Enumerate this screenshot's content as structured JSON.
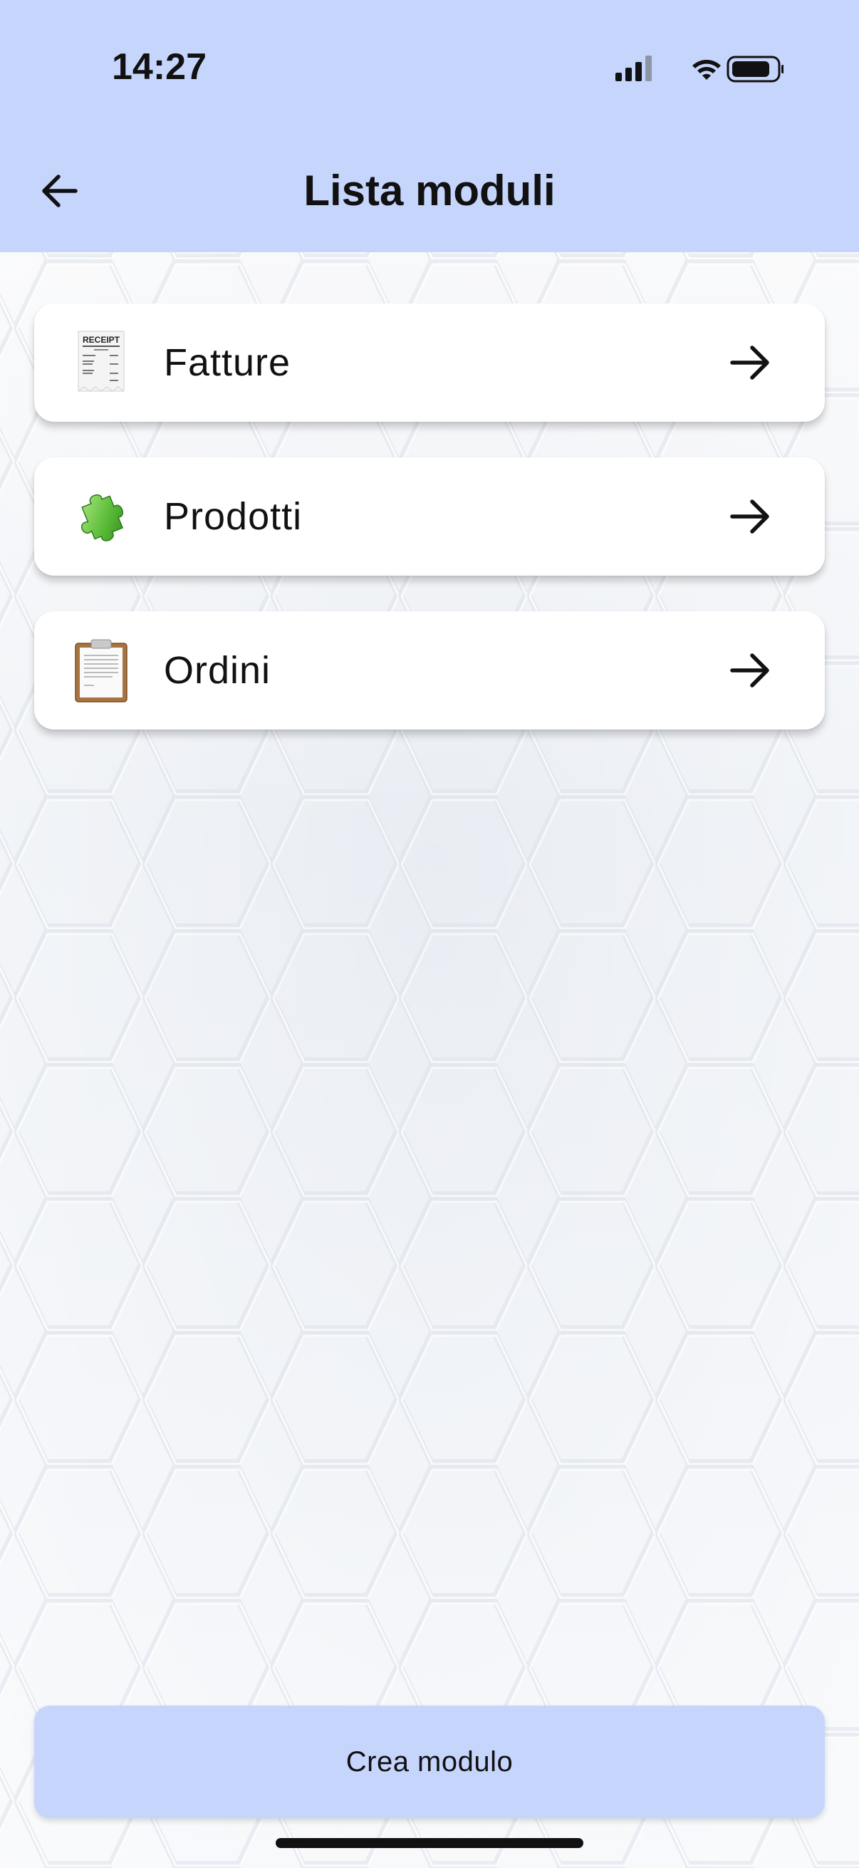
{
  "status_bar": {
    "time": "14:27",
    "icons": [
      "signal-icon",
      "wifi-icon",
      "battery-icon"
    ]
  },
  "header": {
    "title": "Lista moduli",
    "back_icon": "arrow-left-icon",
    "background": "#c6d5fc"
  },
  "modules": [
    {
      "label": "Fatture",
      "icon": "receipt-icon",
      "receipt_text": "RECEIPT"
    },
    {
      "label": "Prodotti",
      "icon": "puzzle-piece-icon"
    },
    {
      "label": "Ordini",
      "icon": "clipboard-icon"
    }
  ],
  "footer": {
    "create_label": "Crea modulo",
    "button_color": "#c6d5fc"
  }
}
